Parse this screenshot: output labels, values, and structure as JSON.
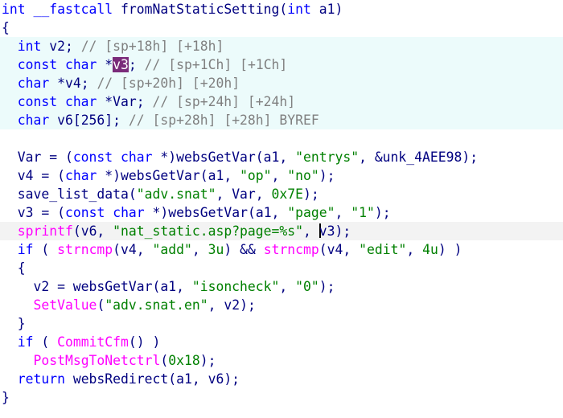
{
  "lines": [
    {
      "kind": "code",
      "segments": [
        {
          "t": "int",
          "c": "kw"
        },
        {
          "t": " __fastcall ",
          "c": "kw"
        },
        {
          "t": "fromNatStaticSetting",
          "c": "id"
        },
        {
          "t": "(",
          "c": "id"
        },
        {
          "t": "int",
          "c": "kw"
        },
        {
          "t": " a1)",
          "c": "id"
        }
      ]
    },
    {
      "kind": "code",
      "segments": [
        {
          "t": "{",
          "c": "id"
        }
      ]
    },
    {
      "kind": "decl",
      "segments": [
        {
          "t": "  int",
          "c": "kw"
        },
        {
          "t": " v2; ",
          "c": "id"
        },
        {
          "t": "// [sp+18h] [+18h]",
          "c": "cmt"
        }
      ]
    },
    {
      "kind": "decl",
      "segments": [
        {
          "t": "  const",
          "c": "kw"
        },
        {
          "t": " char",
          "c": "kw"
        },
        {
          "t": " *",
          "c": "id"
        },
        {
          "t": "v3",
          "c": "hlv"
        },
        {
          "t": "; ",
          "c": "id"
        },
        {
          "t": "// [sp+1Ch] [+1Ch]",
          "c": "cmt"
        }
      ]
    },
    {
      "kind": "decl",
      "segments": [
        {
          "t": "  char",
          "c": "kw"
        },
        {
          "t": " *v4; ",
          "c": "id"
        },
        {
          "t": "// [sp+20h] [+20h]",
          "c": "cmt"
        }
      ]
    },
    {
      "kind": "decl",
      "segments": [
        {
          "t": "  const",
          "c": "kw"
        },
        {
          "t": " char",
          "c": "kw"
        },
        {
          "t": " *Var; ",
          "c": "id"
        },
        {
          "t": "// [sp+24h] [+24h]",
          "c": "cmt"
        }
      ]
    },
    {
      "kind": "decl",
      "segments": [
        {
          "t": "  char",
          "c": "kw"
        },
        {
          "t": " v6[256]; ",
          "c": "id"
        },
        {
          "t": "// [sp+28h] [+28h] BYREF",
          "c": "cmt"
        }
      ]
    },
    {
      "kind": "blank",
      "segments": [
        {
          "t": " ",
          "c": "id"
        }
      ]
    },
    {
      "kind": "code",
      "segments": [
        {
          "t": "  Var = (",
          "c": "id"
        },
        {
          "t": "const",
          "c": "kw"
        },
        {
          "t": " char",
          "c": "kw"
        },
        {
          "t": " *)websGetVar(a1, ",
          "c": "id"
        },
        {
          "t": "\"entrys\"",
          "c": "str"
        },
        {
          "t": ", &unk_4AEE98);",
          "c": "id"
        }
      ]
    },
    {
      "kind": "code",
      "segments": [
        {
          "t": "  v4 = (",
          "c": "id"
        },
        {
          "t": "char",
          "c": "kw"
        },
        {
          "t": " *)websGetVar(a1, ",
          "c": "id"
        },
        {
          "t": "\"op\"",
          "c": "str"
        },
        {
          "t": ", ",
          "c": "id"
        },
        {
          "t": "\"no\"",
          "c": "str"
        },
        {
          "t": ");",
          "c": "id"
        }
      ]
    },
    {
      "kind": "code",
      "segments": [
        {
          "t": "  save_list_data(",
          "c": "id"
        },
        {
          "t": "\"adv.snat\"",
          "c": "str"
        },
        {
          "t": ", Var, ",
          "c": "id"
        },
        {
          "t": "0x7E",
          "c": "num"
        },
        {
          "t": ");",
          "c": "id"
        }
      ]
    },
    {
      "kind": "code",
      "segments": [
        {
          "t": "  ",
          "c": "id"
        },
        {
          "t": "v3",
          "c": "var"
        },
        {
          "t": " = (",
          "c": "id"
        },
        {
          "t": "const",
          "c": "kw"
        },
        {
          "t": " char",
          "c": "kw"
        },
        {
          "t": " *)websGetVar(a1, ",
          "c": "id"
        },
        {
          "t": "\"page\"",
          "c": "str"
        },
        {
          "t": ", ",
          "c": "id"
        },
        {
          "t": "\"1\"",
          "c": "str"
        },
        {
          "t": ");",
          "c": "id"
        }
      ]
    },
    {
      "kind": "cur",
      "segments": [
        {
          "t": "  ",
          "c": "id"
        },
        {
          "t": "sprintf",
          "c": "imp"
        },
        {
          "t": "(v6, ",
          "c": "id"
        },
        {
          "t": "\"nat_static.asp?page=%s\"",
          "c": "str"
        },
        {
          "t": ", ",
          "c": "id"
        },
        {
          "t": "|",
          "c": "caret"
        },
        {
          "t": "v3",
          "c": "var"
        },
        {
          "t": ");",
          "c": "id"
        }
      ]
    },
    {
      "kind": "code",
      "segments": [
        {
          "t": "  if",
          "c": "kw"
        },
        {
          "t": " ( ",
          "c": "id"
        },
        {
          "t": "strncmp",
          "c": "imp"
        },
        {
          "t": "(v4, ",
          "c": "id"
        },
        {
          "t": "\"add\"",
          "c": "str"
        },
        {
          "t": ", ",
          "c": "id"
        },
        {
          "t": "3u",
          "c": "num"
        },
        {
          "t": ") && ",
          "c": "id"
        },
        {
          "t": "strncmp",
          "c": "imp"
        },
        {
          "t": "(v4, ",
          "c": "id"
        },
        {
          "t": "\"edit\"",
          "c": "str"
        },
        {
          "t": ", ",
          "c": "id"
        },
        {
          "t": "4u",
          "c": "num"
        },
        {
          "t": ") )",
          "c": "id"
        }
      ]
    },
    {
      "kind": "code",
      "segments": [
        {
          "t": "  {",
          "c": "id"
        }
      ]
    },
    {
      "kind": "code",
      "segments": [
        {
          "t": "    v2 = websGetVar(a1, ",
          "c": "id"
        },
        {
          "t": "\"isoncheck\"",
          "c": "str"
        },
        {
          "t": ", ",
          "c": "id"
        },
        {
          "t": "\"0\"",
          "c": "str"
        },
        {
          "t": ");",
          "c": "id"
        }
      ]
    },
    {
      "kind": "code",
      "segments": [
        {
          "t": "    ",
          "c": "id"
        },
        {
          "t": "SetValue",
          "c": "imp"
        },
        {
          "t": "(",
          "c": "id"
        },
        {
          "t": "\"adv.snat.en\"",
          "c": "str"
        },
        {
          "t": ", v2);",
          "c": "id"
        }
      ]
    },
    {
      "kind": "code",
      "segments": [
        {
          "t": "  }",
          "c": "id"
        }
      ]
    },
    {
      "kind": "code",
      "segments": [
        {
          "t": "  if",
          "c": "kw"
        },
        {
          "t": " ( ",
          "c": "id"
        },
        {
          "t": "CommitCfm",
          "c": "imp"
        },
        {
          "t": "() )",
          "c": "id"
        }
      ]
    },
    {
      "kind": "code",
      "segments": [
        {
          "t": "    ",
          "c": "id"
        },
        {
          "t": "PostMsgToNetctrl",
          "c": "imp"
        },
        {
          "t": "(",
          "c": "id"
        },
        {
          "t": "0x18",
          "c": "num"
        },
        {
          "t": ");",
          "c": "id"
        }
      ]
    },
    {
      "kind": "code",
      "segments": [
        {
          "t": "  return",
          "c": "kw"
        },
        {
          "t": " websRedirect(a1, v6);",
          "c": "id"
        }
      ]
    },
    {
      "kind": "code",
      "segments": [
        {
          "t": "}",
          "c": "id"
        }
      ]
    }
  ],
  "colors": {
    "keyword": "#0000ff",
    "identifier": "#000080",
    "string": "#008000",
    "comment": "#808080",
    "import": "#ff00ff",
    "decl_bg": "#ecfbfb",
    "current_line_bg": "#f3f3f3",
    "selected_var_bg": "#7a2b7a"
  }
}
